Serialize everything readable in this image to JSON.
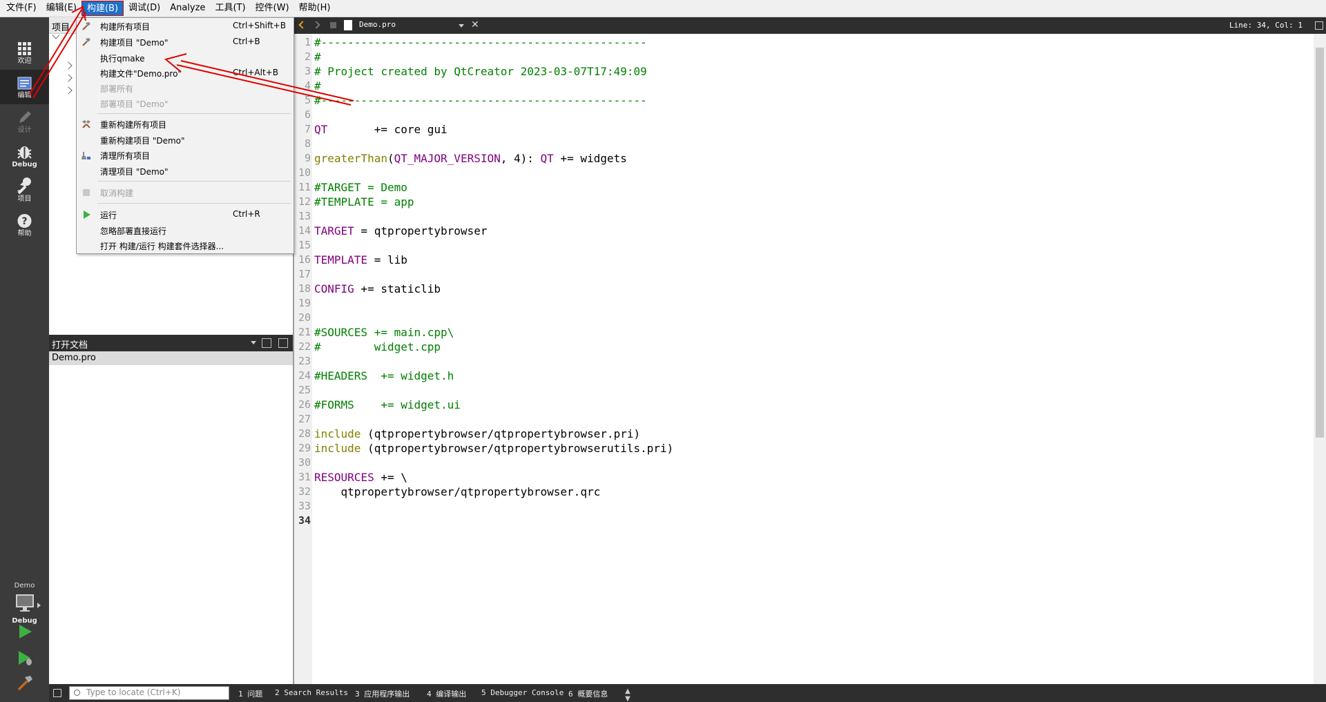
{
  "menubar": {
    "items": [
      "文件(F)",
      "编辑(E)",
      "构建(B)",
      "调试(D)",
      "Analyze",
      "工具(T)",
      "控件(W)",
      "帮助(H)"
    ]
  },
  "modes": {
    "welcome": "欢迎",
    "edit": "编辑",
    "design": "设计",
    "debug": "Debug",
    "projects": "项目",
    "help": "帮助"
  },
  "kit": {
    "project": "Demo",
    "config": "Debug"
  },
  "projects_panel": {
    "title": "项目"
  },
  "open_docs": {
    "title": "打开文档",
    "items": [
      "Demo.pro"
    ]
  },
  "editor": {
    "filename": "Demo.pro",
    "position": "Line: 34, Col: 1",
    "current_line": 34,
    "lines": [
      "#-------------------------------------------------",
      "#",
      "# Project created by QtCreator 2023-03-07T17:49:09",
      "#",
      "#-------------------------------------------------",
      "",
      "QT       += core gui",
      "",
      "greaterThan(QT_MAJOR_VERSION, 4): QT += widgets",
      "",
      "#TARGET = Demo",
      "#TEMPLATE = app",
      "",
      "TARGET = qtpropertybrowser",
      "",
      "TEMPLATE = lib",
      "",
      "CONFIG += staticlib",
      "",
      "",
      "#SOURCES += main.cpp\\",
      "#        widget.cpp",
      "",
      "#HEADERS  += widget.h",
      "",
      "#FORMS    += widget.ui",
      "",
      "include (qtpropertybrowser/qtpropertybrowser.pri)",
      "include (qtpropertybrowser/qtpropertybrowserutils.pri)",
      "",
      "RESOURCES += \\",
      "    qtpropertybrowser/qtpropertybrowser.qrc",
      "",
      ""
    ]
  },
  "build_menu": {
    "build_all": {
      "label": "构建所有项目",
      "shortcut": "Ctrl+Shift+B"
    },
    "build_project": {
      "label": "构建项目 \"Demo\"",
      "shortcut": "Ctrl+B"
    },
    "run_qmake": {
      "label": "执行qmake"
    },
    "build_file": {
      "label": "构建文件\"Demo.pro\"",
      "shortcut": "Ctrl+Alt+B"
    },
    "deploy_all": {
      "label": "部署所有"
    },
    "deploy_project": {
      "label": "部署项目 \"Demo\""
    },
    "rebuild_all": {
      "label": "重新构建所有项目"
    },
    "rebuild_project": {
      "label": "重新构建项目 \"Demo\""
    },
    "clean_all": {
      "label": "清理所有项目"
    },
    "clean_project": {
      "label": "清理项目 \"Demo\""
    },
    "cancel_build": {
      "label": "取消构建"
    },
    "run": {
      "label": "运行",
      "shortcut": "Ctrl+R"
    },
    "run_no_deploy": {
      "label": "忽略部署直接运行"
    },
    "open_kit_selector": {
      "label": "打开 构建/运行 构建套件选择器..."
    }
  },
  "statusbar": {
    "locate_placeholder": "Type to locate (Ctrl+K)",
    "tabs": [
      "1 问题",
      "2 Search Results",
      "3 应用程序输出",
      "4 编译输出",
      "5 Debugger Console",
      "6 概要信息"
    ]
  },
  "colors": {
    "comment": "#008000",
    "keyword": "#800080",
    "function": "#808000",
    "annotation": "#e00000"
  },
  "icons": {
    "welcome": "grid-icon",
    "edit": "document-icon",
    "design": "pencil-icon",
    "debug": "bug-icon",
    "projects": "wrench-icon",
    "help": "question-icon"
  }
}
